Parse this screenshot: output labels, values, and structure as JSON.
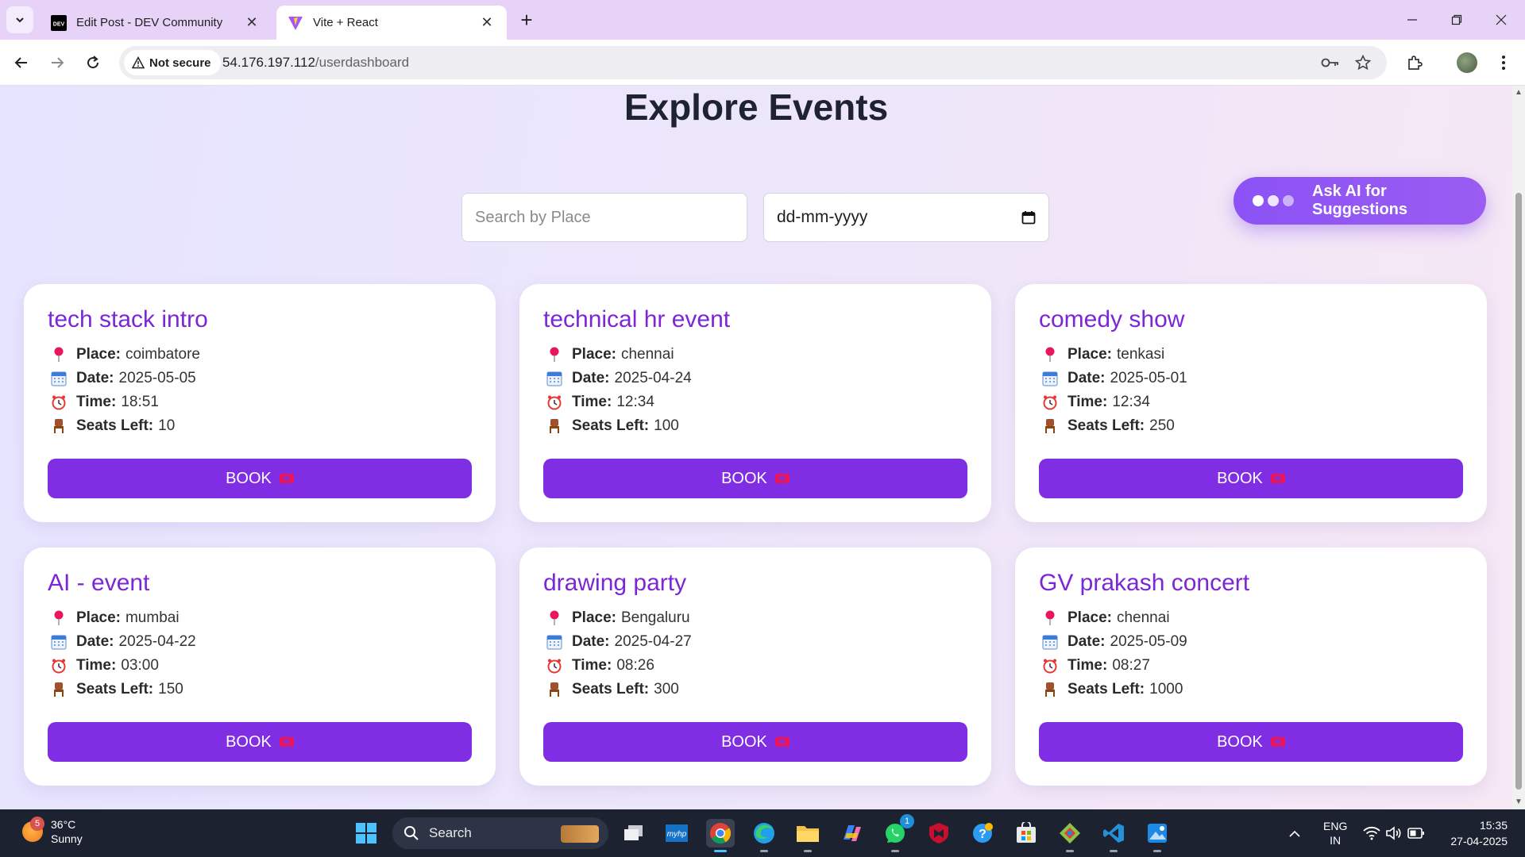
{
  "browser": {
    "tabs": [
      {
        "title": "Edit Post - DEV Community",
        "favicon": "dev-logo",
        "active": false
      },
      {
        "title": "Vite + React",
        "favicon": "vite-logo",
        "active": true
      }
    ],
    "security_label": "Not secure",
    "url_host": "54.176.197.112",
    "url_path": "/userdashboard"
  },
  "page": {
    "title": "Explore Events",
    "search_placeholder": "Search by Place",
    "date_value": "dd-mm-yyyy",
    "ai_button_label": "Ask AI for Suggestions",
    "labels": {
      "place": "Place:",
      "date": "Date:",
      "time": "Time:",
      "seats": "Seats Left:"
    },
    "book_label": "BOOK",
    "events": [
      {
        "name": "tech stack intro",
        "place": "coimbatore",
        "date": "2025-05-05",
        "time": "18:51",
        "seats": "10"
      },
      {
        "name": "technical hr event",
        "place": "chennai",
        "date": "2025-04-24",
        "time": "12:34",
        "seats": "100"
      },
      {
        "name": "comedy show",
        "place": "tenkasi",
        "date": "2025-05-01",
        "time": "12:34",
        "seats": "250"
      },
      {
        "name": "AI - event",
        "place": "mumbai",
        "date": "2025-04-22",
        "time": "03:00",
        "seats": "150"
      },
      {
        "name": "drawing party",
        "place": "Bengaluru",
        "date": "2025-04-27",
        "time": "08:26",
        "seats": "300"
      },
      {
        "name": "GV prakash concert",
        "place": "chennai",
        "date": "2025-05-09",
        "time": "08:27",
        "seats": "1000"
      }
    ]
  },
  "taskbar": {
    "weather_badge": "5",
    "temperature": "36°C",
    "condition": "Sunny",
    "search_label": "Search",
    "whatsapp_badge": "1",
    "language": "ENG",
    "region": "IN",
    "time": "15:35",
    "date": "27-04-2025"
  },
  "colors": {
    "accent": "#7f2ee3",
    "title_purple": "#7c26d6",
    "ai_button": "#8b52f5"
  }
}
